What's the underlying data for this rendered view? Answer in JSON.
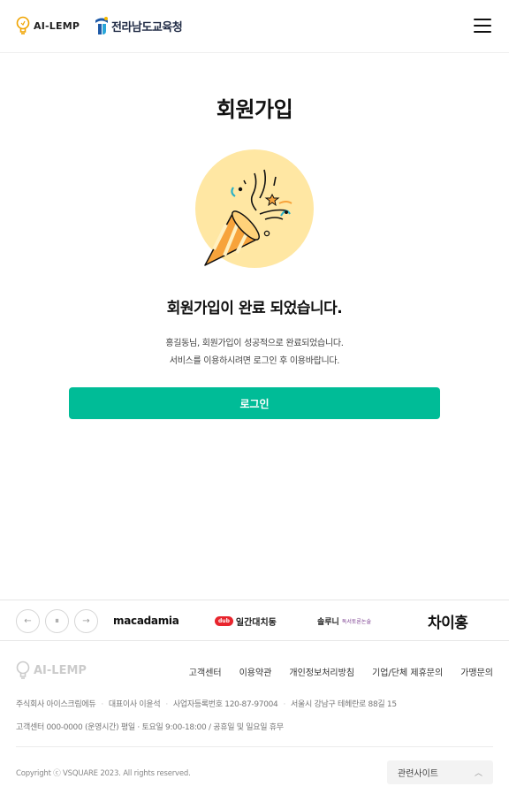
{
  "header": {
    "logo_ai_text": "AI-LEMP",
    "logo_office_text": "전라남도교육청",
    "menu_icon": "hamburger-menu-icon"
  },
  "main": {
    "title": "회원가입",
    "illustration_icon": "party-popper-icon",
    "complete_title": "회원가입이 완료 되었습니다.",
    "desc_line1": "홍길동님, 회원가입이 성공적으로 완료되었습니다.",
    "desc_line2": "서비스를 이용하시려면 로그인 후 이용바랍니다.",
    "login_button": "로그인",
    "accent_color": "#00bc97",
    "illustration_bg": "#ffe7a3"
  },
  "partners": {
    "controls": {
      "prev_icon": "arrow-left-icon",
      "pause_icon": "pause-icon",
      "next_icon": "arrow-right-icon"
    },
    "macadamia": "macadamia",
    "ilgan_badge": "dub",
    "ilgan": "일간대치동",
    "solruni": "솔루니",
    "solruni_sub": "독서토론논술",
    "chai": "차이홍"
  },
  "footer": {
    "logo_text": "AI-LEMP",
    "links": [
      "고객센터",
      "이용약관",
      "개인정보처리방침",
      "기업/단체 제휴문의",
      "가맹문의"
    ],
    "company": "주식회사 아이스크림에듀",
    "ceo": "대표이사 이윤석",
    "biz_no": "사업자등록번호 120-87-97004",
    "address": "서울시 강남구 테헤란로 88길 15",
    "cs_hours": "고객센터 000-0000 (운영시간) 평일 · 토요일 9:00-18:00 / 공휴일 및 일요일 휴무",
    "copyright": "Copyright ⓒ VSQUARE 2023. All rights reserved.",
    "related_label": "관련사이트",
    "related_icon": "chevron-up-icon"
  }
}
